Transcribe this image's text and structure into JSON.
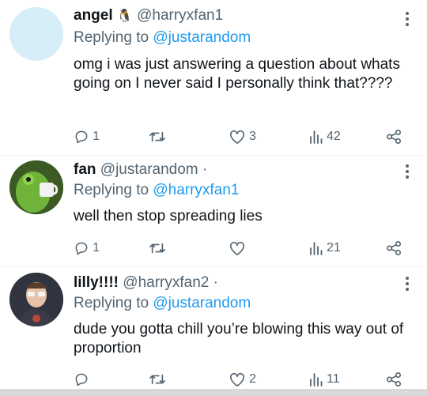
{
  "tweets": [
    {
      "name": "angel",
      "name_emoji": "🐧",
      "handle": "@harryxfan1",
      "reply_prefix": "Replying to",
      "reply_to": "@justarandom",
      "text": "omg i was just answering a question about whats going on I never said I personally think that????",
      "replies": "1",
      "retweets": "",
      "likes": "3",
      "views": "42"
    },
    {
      "name": "fan",
      "handle": "@justarandom",
      "dot": "·",
      "reply_prefix": "Replying to",
      "reply_to": "@harryxfan1",
      "text": "well then stop spreading lies",
      "replies": "1",
      "retweets": "",
      "likes": "",
      "views": "21"
    },
    {
      "name": "lilly!!!!",
      "handle": "@harryxfan2",
      "dot": "·",
      "reply_prefix": "Replying to",
      "reply_to": "@justarandom",
      "text": "dude you gotta chill you’re blowing this way out of proportion",
      "replies": "",
      "retweets": "",
      "likes": "2",
      "views": "11"
    }
  ],
  "icons": {
    "reply": "reply-icon",
    "retweet": "retweet-icon",
    "like": "heart-icon",
    "views": "views-icon",
    "share": "share-icon",
    "more": "more-vertical-icon"
  }
}
